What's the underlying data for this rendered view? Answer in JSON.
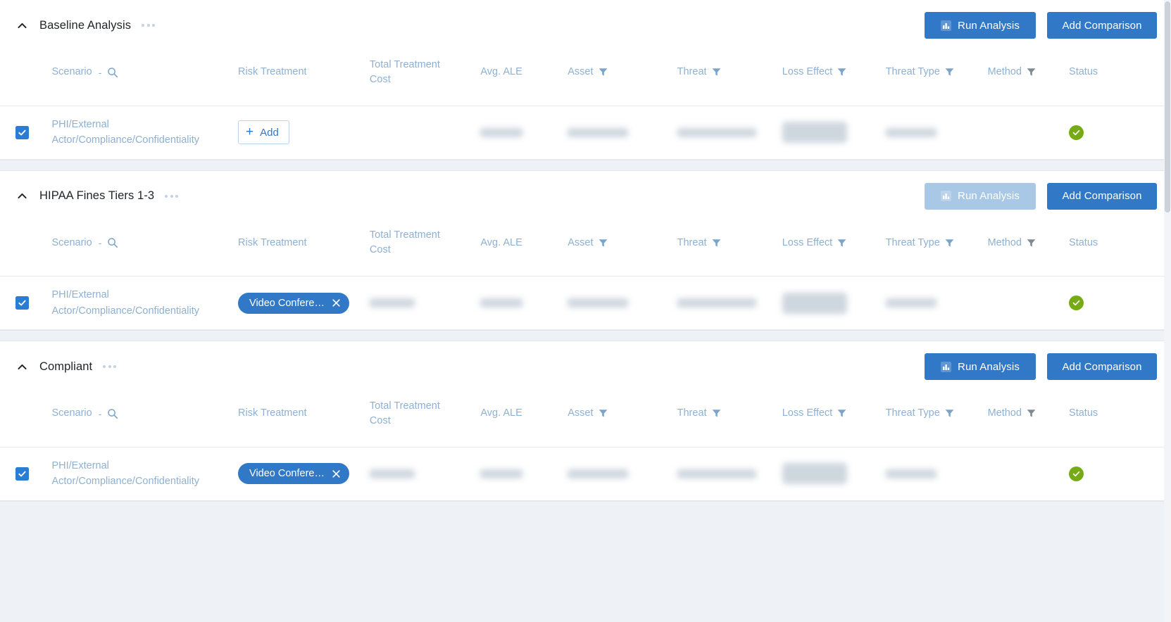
{
  "columns": [
    {
      "key": "scenario",
      "label": "Scenario",
      "sortable": true,
      "search": true,
      "filter": false,
      "two_line": false
    },
    {
      "key": "treatment",
      "label": "Risk Treatment",
      "sortable": false,
      "search": false,
      "filter": false,
      "two_line": false
    },
    {
      "key": "cost",
      "label": "Total Treatment Cost",
      "sortable": false,
      "search": false,
      "filter": false,
      "two_line": true
    },
    {
      "key": "ale",
      "label": "Avg. ALE",
      "sortable": false,
      "search": false,
      "filter": false,
      "two_line": false
    },
    {
      "key": "asset",
      "label": "Asset",
      "sortable": false,
      "search": false,
      "filter": true,
      "two_line": false
    },
    {
      "key": "threat",
      "label": "Threat",
      "sortable": false,
      "search": false,
      "filter": true,
      "two_line": false
    },
    {
      "key": "loss",
      "label": "Loss Effect",
      "sortable": false,
      "search": false,
      "filter": true,
      "two_line": true
    },
    {
      "key": "ttype",
      "label": "Threat Type",
      "sortable": false,
      "search": false,
      "filter": true,
      "two_line": true
    },
    {
      "key": "method",
      "label": "Method",
      "sortable": false,
      "search": false,
      "filter": true,
      "two_line": false,
      "filter_active": true
    },
    {
      "key": "status",
      "label": "Status",
      "sortable": false,
      "search": false,
      "filter": false,
      "two_line": false
    }
  ],
  "colors": {
    "accent": "#3178c6",
    "accent_disabled": "#a8c8e6",
    "header_text": "#8fb0d0",
    "title_text": "#1f2328",
    "status_green": "#77ab15",
    "page_bg": "#eef1f5",
    "filter_active": "#808a93"
  },
  "buttons": {
    "run_analysis": "Run Analysis",
    "add_comparison": "Add Comparison",
    "add_treatment": "Add"
  },
  "icons": {
    "collapse": "chevron-up-icon",
    "overflow": "more-options-icon",
    "run": "bar-chart-icon",
    "search": "search-icon",
    "filter": "filter-icon",
    "checkbox": "checkbox-checked-icon",
    "status": "status-success-icon",
    "chip_remove": "close-icon",
    "add": "plus-icon"
  },
  "sections": [
    {
      "title": "Baseline Analysis",
      "collapsed": false,
      "run_enabled": true,
      "rows": [
        {
          "selected": true,
          "scenario": "PHI/External Actor/Compliance/Confidentiality",
          "treatment_kind": "add",
          "treatment_label": "Add",
          "cost": "",
          "ale": "",
          "asset": "",
          "threat": "",
          "loss": "",
          "ttype": "",
          "method": "",
          "status": "success",
          "redacted_cost": false
        }
      ]
    },
    {
      "title": "HIPAA Fines Tiers 1-3",
      "collapsed": false,
      "run_enabled": false,
      "rows": [
        {
          "selected": true,
          "scenario": "PHI/External Actor/Compliance/Confidentiality",
          "treatment_kind": "chip",
          "treatment_label": "Video Confere…",
          "cost": "",
          "ale": "",
          "asset": "",
          "threat": "",
          "loss": "",
          "ttype": "",
          "method": "",
          "status": "success",
          "redacted_cost": true
        }
      ]
    },
    {
      "title": "Compliant",
      "collapsed": false,
      "run_enabled": true,
      "rows": [
        {
          "selected": true,
          "scenario": "PHI/External Actor/Compliance/Confidentiality",
          "treatment_kind": "chip",
          "treatment_label": "Video Confere…",
          "cost": "",
          "ale": "",
          "asset": "",
          "threat": "",
          "loss": "",
          "ttype": "",
          "method": "",
          "status": "success",
          "redacted_cost": true
        }
      ]
    }
  ]
}
